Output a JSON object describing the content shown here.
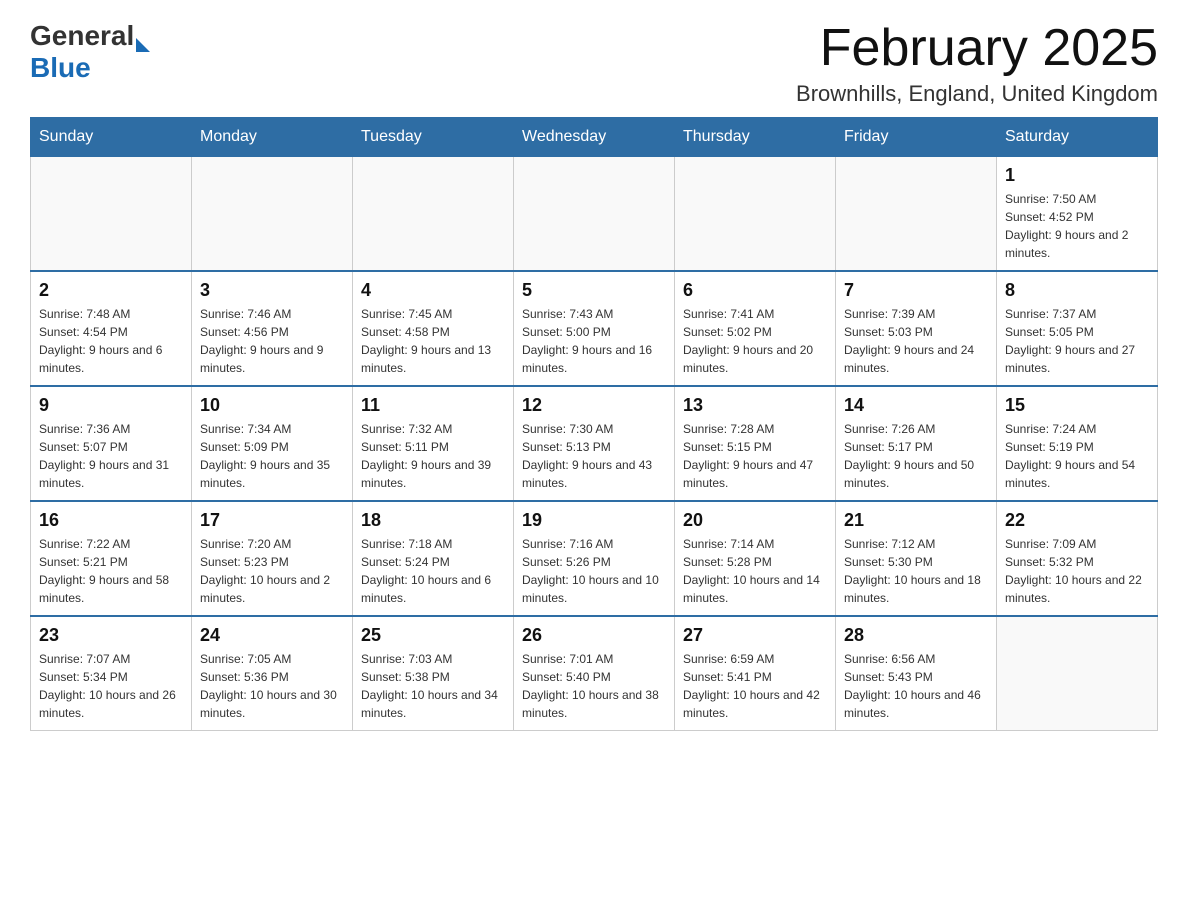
{
  "header": {
    "title": "February 2025",
    "subtitle": "Brownhills, England, United Kingdom",
    "logo_general": "General",
    "logo_blue": "Blue"
  },
  "days_of_week": [
    "Sunday",
    "Monday",
    "Tuesday",
    "Wednesday",
    "Thursday",
    "Friday",
    "Saturday"
  ],
  "weeks": [
    [
      {
        "day": "",
        "info": ""
      },
      {
        "day": "",
        "info": ""
      },
      {
        "day": "",
        "info": ""
      },
      {
        "day": "",
        "info": ""
      },
      {
        "day": "",
        "info": ""
      },
      {
        "day": "",
        "info": ""
      },
      {
        "day": "1",
        "info": "Sunrise: 7:50 AM\nSunset: 4:52 PM\nDaylight: 9 hours and 2 minutes."
      }
    ],
    [
      {
        "day": "2",
        "info": "Sunrise: 7:48 AM\nSunset: 4:54 PM\nDaylight: 9 hours and 6 minutes."
      },
      {
        "day": "3",
        "info": "Sunrise: 7:46 AM\nSunset: 4:56 PM\nDaylight: 9 hours and 9 minutes."
      },
      {
        "day": "4",
        "info": "Sunrise: 7:45 AM\nSunset: 4:58 PM\nDaylight: 9 hours and 13 minutes."
      },
      {
        "day": "5",
        "info": "Sunrise: 7:43 AM\nSunset: 5:00 PM\nDaylight: 9 hours and 16 minutes."
      },
      {
        "day": "6",
        "info": "Sunrise: 7:41 AM\nSunset: 5:02 PM\nDaylight: 9 hours and 20 minutes."
      },
      {
        "day": "7",
        "info": "Sunrise: 7:39 AM\nSunset: 5:03 PM\nDaylight: 9 hours and 24 minutes."
      },
      {
        "day": "8",
        "info": "Sunrise: 7:37 AM\nSunset: 5:05 PM\nDaylight: 9 hours and 27 minutes."
      }
    ],
    [
      {
        "day": "9",
        "info": "Sunrise: 7:36 AM\nSunset: 5:07 PM\nDaylight: 9 hours and 31 minutes."
      },
      {
        "day": "10",
        "info": "Sunrise: 7:34 AM\nSunset: 5:09 PM\nDaylight: 9 hours and 35 minutes."
      },
      {
        "day": "11",
        "info": "Sunrise: 7:32 AM\nSunset: 5:11 PM\nDaylight: 9 hours and 39 minutes."
      },
      {
        "day": "12",
        "info": "Sunrise: 7:30 AM\nSunset: 5:13 PM\nDaylight: 9 hours and 43 minutes."
      },
      {
        "day": "13",
        "info": "Sunrise: 7:28 AM\nSunset: 5:15 PM\nDaylight: 9 hours and 47 minutes."
      },
      {
        "day": "14",
        "info": "Sunrise: 7:26 AM\nSunset: 5:17 PM\nDaylight: 9 hours and 50 minutes."
      },
      {
        "day": "15",
        "info": "Sunrise: 7:24 AM\nSunset: 5:19 PM\nDaylight: 9 hours and 54 minutes."
      }
    ],
    [
      {
        "day": "16",
        "info": "Sunrise: 7:22 AM\nSunset: 5:21 PM\nDaylight: 9 hours and 58 minutes."
      },
      {
        "day": "17",
        "info": "Sunrise: 7:20 AM\nSunset: 5:23 PM\nDaylight: 10 hours and 2 minutes."
      },
      {
        "day": "18",
        "info": "Sunrise: 7:18 AM\nSunset: 5:24 PM\nDaylight: 10 hours and 6 minutes."
      },
      {
        "day": "19",
        "info": "Sunrise: 7:16 AM\nSunset: 5:26 PM\nDaylight: 10 hours and 10 minutes."
      },
      {
        "day": "20",
        "info": "Sunrise: 7:14 AM\nSunset: 5:28 PM\nDaylight: 10 hours and 14 minutes."
      },
      {
        "day": "21",
        "info": "Sunrise: 7:12 AM\nSunset: 5:30 PM\nDaylight: 10 hours and 18 minutes."
      },
      {
        "day": "22",
        "info": "Sunrise: 7:09 AM\nSunset: 5:32 PM\nDaylight: 10 hours and 22 minutes."
      }
    ],
    [
      {
        "day": "23",
        "info": "Sunrise: 7:07 AM\nSunset: 5:34 PM\nDaylight: 10 hours and 26 minutes."
      },
      {
        "day": "24",
        "info": "Sunrise: 7:05 AM\nSunset: 5:36 PM\nDaylight: 10 hours and 30 minutes."
      },
      {
        "day": "25",
        "info": "Sunrise: 7:03 AM\nSunset: 5:38 PM\nDaylight: 10 hours and 34 minutes."
      },
      {
        "day": "26",
        "info": "Sunrise: 7:01 AM\nSunset: 5:40 PM\nDaylight: 10 hours and 38 minutes."
      },
      {
        "day": "27",
        "info": "Sunrise: 6:59 AM\nSunset: 5:41 PM\nDaylight: 10 hours and 42 minutes."
      },
      {
        "day": "28",
        "info": "Sunrise: 6:56 AM\nSunset: 5:43 PM\nDaylight: 10 hours and 46 minutes."
      },
      {
        "day": "",
        "info": ""
      }
    ]
  ]
}
